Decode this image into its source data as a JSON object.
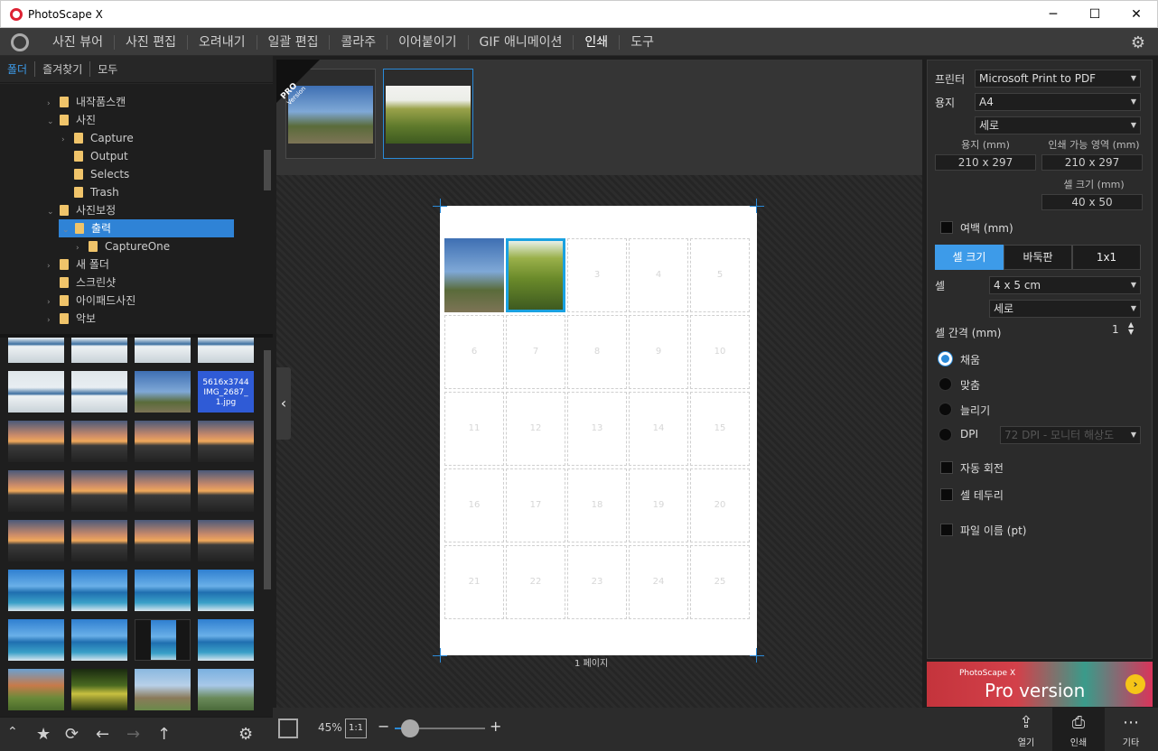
{
  "window": {
    "title": "PhotoScape X",
    "minimize": "─",
    "maximize": "☐",
    "close": "✕"
  },
  "menu": {
    "tabs": [
      "사진 뷰어",
      "사진 편집",
      "오려내기",
      "일괄 편집",
      "콜라주",
      "이어붙이기",
      "GIF 애니메이션",
      "인쇄",
      "도구"
    ],
    "active": "인쇄"
  },
  "left": {
    "tabs": [
      "폴더",
      "즐겨찾기",
      "모두"
    ],
    "tree": [
      {
        "label": "내작품스캔",
        "depth": 0,
        "arrow": "›"
      },
      {
        "label": "사진",
        "depth": 0,
        "arrow": "⌄"
      },
      {
        "label": "Capture",
        "depth": 1,
        "arrow": "›"
      },
      {
        "label": "Output",
        "depth": 1,
        "arrow": ""
      },
      {
        "label": "Selects",
        "depth": 1,
        "arrow": ""
      },
      {
        "label": "Trash",
        "depth": 1,
        "arrow": ""
      },
      {
        "label": "사진보정",
        "depth": 0,
        "arrow": "⌄"
      },
      {
        "label": "출력",
        "depth": 1,
        "arrow": "⌄",
        "selected": true
      },
      {
        "label": "CaptureOne",
        "depth": 2,
        "arrow": "›"
      },
      {
        "label": "새 폴더",
        "depth": 0,
        "arrow": "›"
      },
      {
        "label": "스크린샷",
        "depth": 0,
        "arrow": ""
      },
      {
        "label": "아이패드사진",
        "depth": 0,
        "arrow": "›"
      },
      {
        "label": "악보",
        "depth": 0,
        "arrow": "›"
      }
    ],
    "hover_thumb": {
      "size": "5616x3744",
      "name_line1": "IMG_2687_",
      "name_line2": "1.jpg"
    }
  },
  "center": {
    "pro_badge": {
      "line1": "PRO",
      "line2": "Version"
    },
    "cell_numbers": [
      "3",
      "4",
      "5",
      "6",
      "7",
      "8",
      "9",
      "10",
      "11",
      "12",
      "13",
      "14",
      "15",
      "16",
      "17",
      "18",
      "19",
      "20",
      "21",
      "22",
      "23",
      "24",
      "25"
    ],
    "page_label": "1 페이지",
    "zoom": "45%",
    "one_to_one": "1:1",
    "collapse_icon": "‹"
  },
  "right": {
    "printer_label": "프린터",
    "printer_value": "Microsoft Print to PDF",
    "paper_label": "용지",
    "paper_value": "A4",
    "orientation_value": "세로",
    "paper_mm_label": "용지 (mm)",
    "printable_label": "인쇄 가능 영역 (mm)",
    "paper_mm_value": "210 x 297",
    "printable_value": "210 x 297",
    "cell_size_label": "셀 크기 (mm)",
    "cell_size_value": "40 x 50",
    "margin_label": "여백 (mm)",
    "segments": [
      "셀 크기",
      "바둑판",
      "1x1"
    ],
    "cell_label": "셀",
    "cell_value": "4 x 5 cm",
    "cell_orientation": "세로",
    "spacing_label": "셀 간격 (mm)",
    "spacing_value": "1",
    "fit_options": [
      "채움",
      "맞춤",
      "늘리기",
      "DPI"
    ],
    "dpi_value": "72 DPI - 모니터 해상도",
    "auto_rotate": "자동 회전",
    "cell_border": "셀 테두리",
    "file_name": "파일 이름 (pt)"
  },
  "banner": {
    "small": "PhotoScape X",
    "big": "Pro version"
  },
  "actions": {
    "open": "열기",
    "print": "인쇄",
    "more": "기타"
  },
  "colors": {
    "accent": "#3d9be9",
    "selection": "#1aa1e0",
    "folder": "#f0c46a"
  }
}
